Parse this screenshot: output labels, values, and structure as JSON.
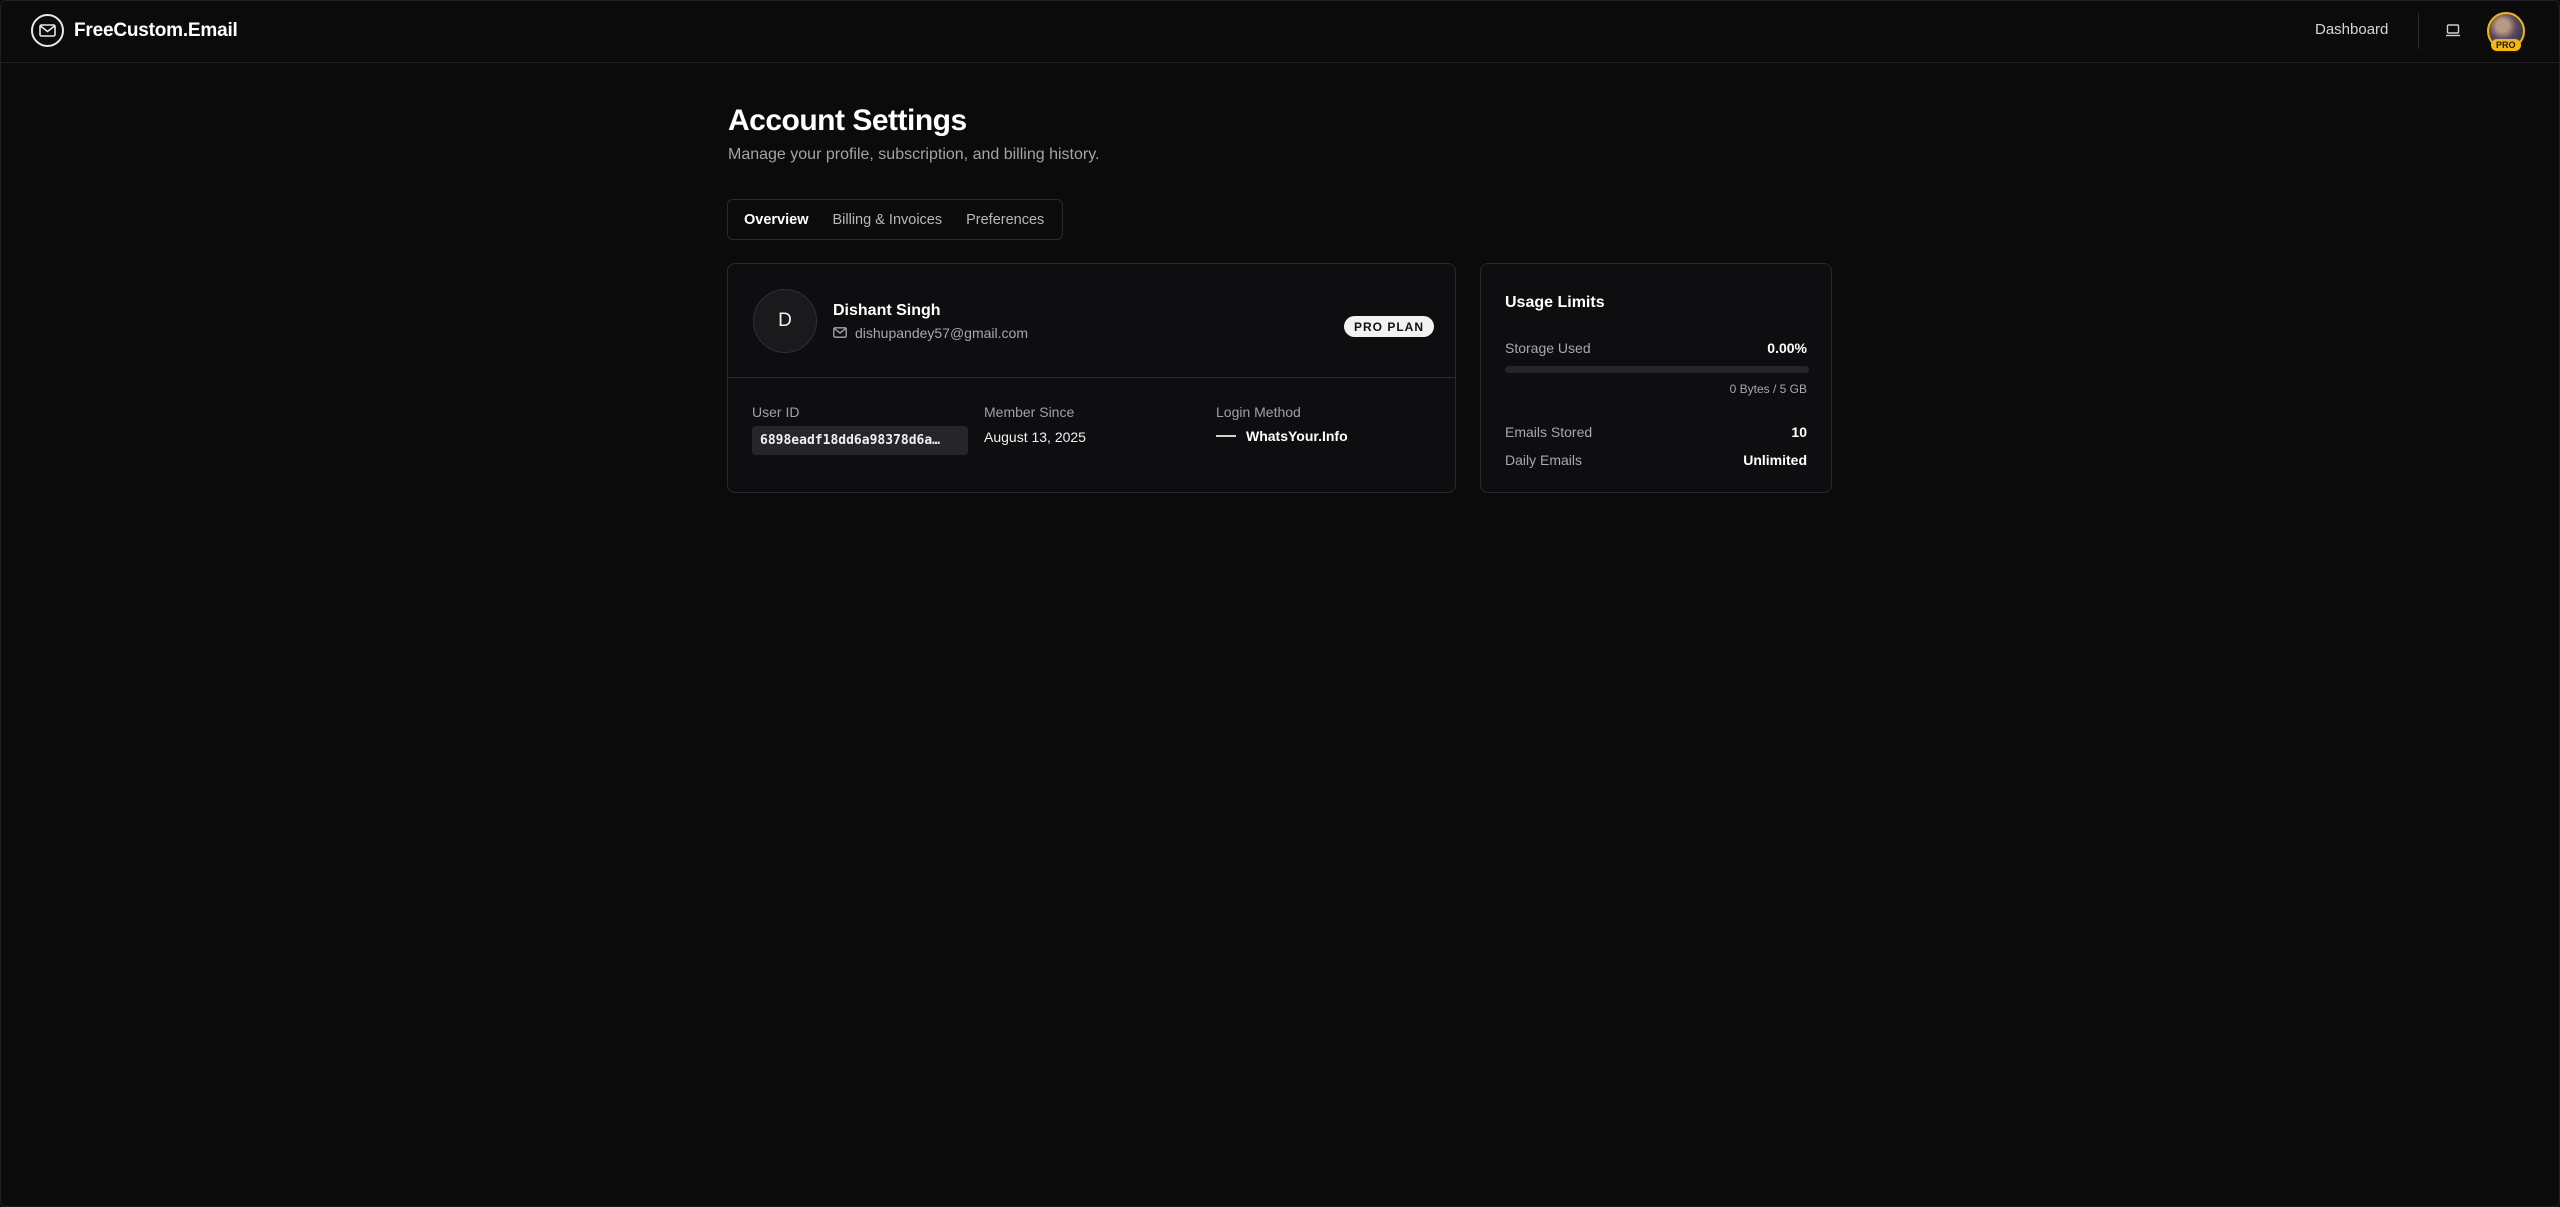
{
  "header": {
    "brand": "FreeCustom.Email",
    "nav_dashboard": "Dashboard",
    "avatar_badge": "PRO"
  },
  "page": {
    "title": "Account Settings",
    "subtitle": "Manage your profile, subscription, and billing history."
  },
  "tabs": [
    {
      "label": "Overview",
      "active": true
    },
    {
      "label": "Billing & Invoices",
      "active": false
    },
    {
      "label": "Preferences",
      "active": false
    }
  ],
  "profile": {
    "initial": "D",
    "name": "Dishant Singh",
    "email": "dishupandey57@gmail.com",
    "plan_badge": "PRO PLAN",
    "user_id_label": "User ID",
    "user_id": "6898eadf18dd6a98378d6a…",
    "member_since_label": "Member Since",
    "member_since": "August 13, 2025",
    "login_method_label": "Login Method",
    "login_method": "WhatsYour.Info"
  },
  "usage": {
    "title": "Usage Limits",
    "storage_label": "Storage Used",
    "storage_value": "0.00%",
    "storage_fraction": 0.0,
    "storage_detail": "0 Bytes / 5 GB",
    "emails_stored_label": "Emails Stored",
    "emails_stored": "10",
    "daily_emails_label": "Daily Emails",
    "daily_emails": "Unlimited"
  },
  "colors": {
    "background": "#0b0b0c",
    "accent_pro": "#f6b80d"
  },
  "icons": {
    "brand": "mail-circle-icon",
    "device": "laptop-icon",
    "email": "mail-icon",
    "login": "dash-icon"
  }
}
